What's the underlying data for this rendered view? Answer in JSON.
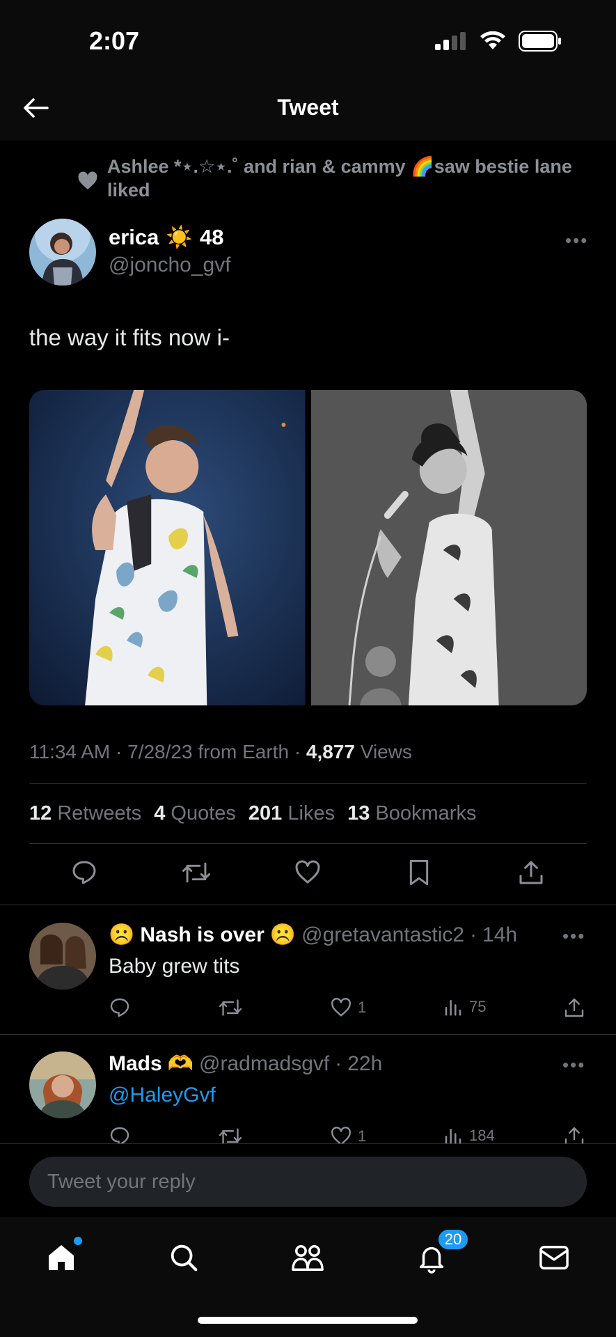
{
  "status_bar": {
    "time": "2:07",
    "icons": [
      "signal-icon",
      "wifi-icon",
      "battery-icon"
    ]
  },
  "nav": {
    "title": "Tweet",
    "back_icon": "arrow-left-icon"
  },
  "social_context": {
    "text": "Ashlee *⋆.☆⋆.˚ and rian & cammy 🌈saw bestie lane liked"
  },
  "tweet": {
    "author_name": "erica",
    "author_emoji": "☀️",
    "author_suffix": "48",
    "author_handle": "@joncho_gvf",
    "text": "the way it fits now i-",
    "time": "11:34 AM",
    "date": "7/28/23",
    "source": "from Earth",
    "views_count": "4,877",
    "views_label": "Views",
    "stats": {
      "retweets_count": "12",
      "retweets_label": "Retweets",
      "quotes_count": "4",
      "quotes_label": "Quotes",
      "likes_count": "201",
      "likes_label": "Likes",
      "bookmarks_count": "13",
      "bookmarks_label": "Bookmarks"
    }
  },
  "replies": [
    {
      "name_prefix": "☹️",
      "name": "Nash is over",
      "name_suffix": "☹️",
      "handle": "@gretavantastic2",
      "time": "14h",
      "text": "Baby grew tits",
      "likes": "1",
      "views": "75"
    },
    {
      "name_prefix": "",
      "name": "Mads",
      "name_suffix": "🫶",
      "handle": "@radmadsgvf",
      "time": "22h",
      "text": "@HaleyGvf",
      "likes": "1",
      "views": "184"
    }
  ],
  "reply_box": {
    "placeholder": "Tweet your reply"
  },
  "tab_bar": {
    "notifications_badge": "20"
  },
  "colors": {
    "accent": "#1d9bf0",
    "background": "#000000",
    "muted": "#71767b"
  }
}
